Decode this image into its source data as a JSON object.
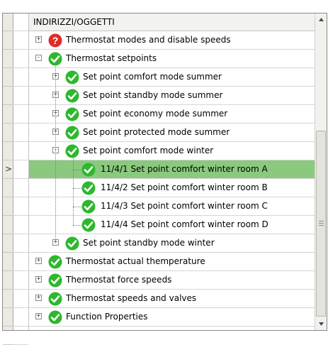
{
  "header": {
    "title": "INDIRIZZI/OGGETTI"
  },
  "tree": {
    "rows": [
      {
        "label": "Thermostat modes and disable speeds",
        "status": "error",
        "expander": "+",
        "level": 0
      },
      {
        "label": "Thermostat setpoints",
        "status": "ok",
        "expander": "-",
        "level": 0
      },
      {
        "label": "Set point comfort mode summer",
        "status": "ok",
        "expander": "+",
        "level": 1
      },
      {
        "label": "Set point standby mode summer",
        "status": "ok",
        "expander": "+",
        "level": 1
      },
      {
        "label": "Set point economy mode summer",
        "status": "ok",
        "expander": "+",
        "level": 1
      },
      {
        "label": "Set point protected mode summer",
        "status": "ok",
        "expander": "+",
        "level": 1
      },
      {
        "label": "Set point comfort mode winter",
        "status": "ok",
        "expander": "-",
        "level": 1
      },
      {
        "label": "11/4/1 Set point comfort winter room A",
        "status": "ok",
        "expander": "",
        "level": 2,
        "selected": true
      },
      {
        "label": "11/4/2 Set point comfort winter room B",
        "status": "ok",
        "expander": "",
        "level": 2
      },
      {
        "label": "11/4/3 Set point comfort winter room C",
        "status": "ok",
        "expander": "",
        "level": 2
      },
      {
        "label": "11/4/4 Set point comfort winter room D",
        "status": "ok",
        "expander": "",
        "level": 2
      },
      {
        "label": "Set point standby mode winter",
        "status": "ok",
        "expander": "+",
        "level": 1
      },
      {
        "label": "Thermostat actual themperature",
        "status": "ok",
        "expander": "+",
        "level": 0
      },
      {
        "label": "Thermostat force speeds",
        "status": "ok",
        "expander": "+",
        "level": 0
      },
      {
        "label": "Thermostat speeds and valves",
        "status": "ok",
        "expander": "+",
        "level": 0
      },
      {
        "label": "Function Properties",
        "status": "ok",
        "expander": "+",
        "level": 0
      }
    ]
  },
  "row_header": {
    "current_row_marker": ">"
  },
  "colors": {
    "selected_row": "#8ac97e",
    "ok_icon": "#2db82d",
    "error_icon": "#e02a2a"
  },
  "icons": {
    "ok": "check-circle-icon",
    "error": "question-circle-icon"
  }
}
